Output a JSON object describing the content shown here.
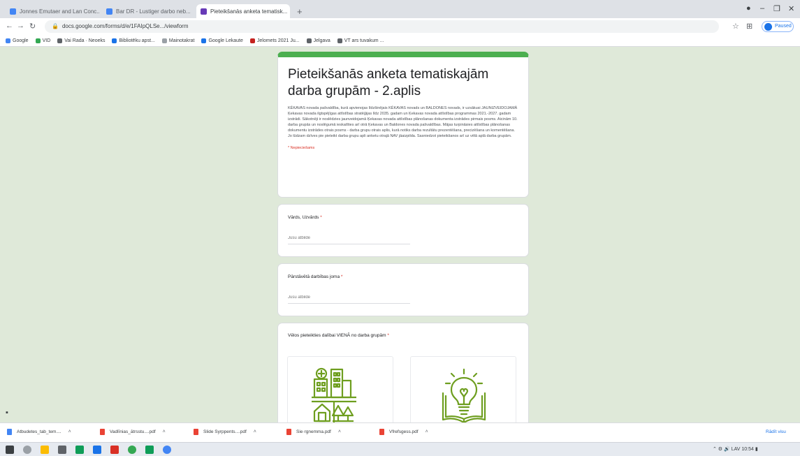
{
  "browser": {
    "tabs": [
      {
        "label": "Jonnes Emutaer and Lan Conc...",
        "color": "#4285f4"
      },
      {
        "label": "Bar DR - Lustiger darbo neb...",
        "color": "#4285f4"
      },
      {
        "label": "Pieteikšanās anketa tematisk...",
        "color": "#673ab7"
      }
    ],
    "url": "docs.google.com/forms/d/e/1FAIpQLSe.../viewform",
    "profile_label": "Paused",
    "bookmarks": [
      {
        "label": "Google",
        "color": "#4285f4"
      },
      {
        "label": "VID",
        "color": "#34a853"
      },
      {
        "label": "Vai Rada · Neoeks",
        "color": "#5f6368"
      },
      {
        "label": "Bibliotēku apst...",
        "color": "#1a73e8"
      },
      {
        "label": "Mainotakrat",
        "color": "#9aa0a6"
      },
      {
        "label": "Google Lekaute",
        "color": "#1a73e8"
      },
      {
        "label": "Jelomets 2021 Ju...",
        "color": "#c5221f"
      },
      {
        "label": "Jelgava",
        "color": "#5f6368"
      },
      {
        "label": "VT ars tuvakum ...",
        "color": "#5f6368"
      }
    ]
  },
  "form": {
    "accent_color": "#4caf50",
    "title": "Pieteikšanās anketa tematiskajām darba grupām - 2.aplis",
    "description": "KĒKAVAS novada pašvaldība, kurā apvienojas līdzšinējais KĒKAVAS novads un BALDONES novads, ir uzsākusi JAUNIZVEIDOJAMĀ Ķekavas novada ilgtspējīgas attīstības stratēģijas līdz 2035. gadam un Ķekavas novada attīstības programmas 2021.-2027. gadam izstrādi. Sākotnēji ir noslēdzies jaunveidojamā Ķekavas novada attīstības plānošanas dokumenta izstrādes pirmais posms. Aicinām 10. darba grupās un noslēgumā ieskatīties arī otrā Ķekavas un Baldones novada pašvaldības. Mājas turpināsies attīstības plānošanas dokumentu izstrādes otrais posms - darba grupu otrais aplis, kurā notiks darba rezultātu prezentēšana, precizēšana un komentēšana. Jo lūdzam dzīves pie pieteikt darba grupu apli anketu otrajā NAV jāaizpilda. Sasniedzot pieteikšanos arī uz vēlā aplā darba grupām.",
    "required_note": "* Nepieciešams",
    "questions": [
      {
        "label": "Vārds, Uzvārds",
        "required_mark": "*",
        "placeholder": "Jūsu atbilde"
      },
      {
        "label": "Pārstāvētā darbības joma",
        "required_mark": "*",
        "placeholder": "Jūsu atbilde"
      },
      {
        "label": "Vēlos pieteikties dalībai VIENĀ no darba grupām",
        "required_mark": "*"
      }
    ],
    "icon_color": "#6e9e1f"
  },
  "downloads": [
    {
      "label": "Atbudetes_tab_tem....",
      "color": "#4285f4"
    },
    {
      "label": "Vadlīnias_ātrsstu....pdf",
      "color": "#ea4335"
    },
    {
      "label": "Slide Syrppents....pdf",
      "color": "#ea4335"
    },
    {
      "label": "Sie·rgnemma.pdf",
      "color": "#ea4335"
    },
    {
      "label": "Vfrefsgess.pdf",
      "color": "#ea4335"
    }
  ],
  "downloads_show_all": "Rādīt visu",
  "taskbar": {
    "clock_time": "10:54",
    "language": "LAV"
  }
}
